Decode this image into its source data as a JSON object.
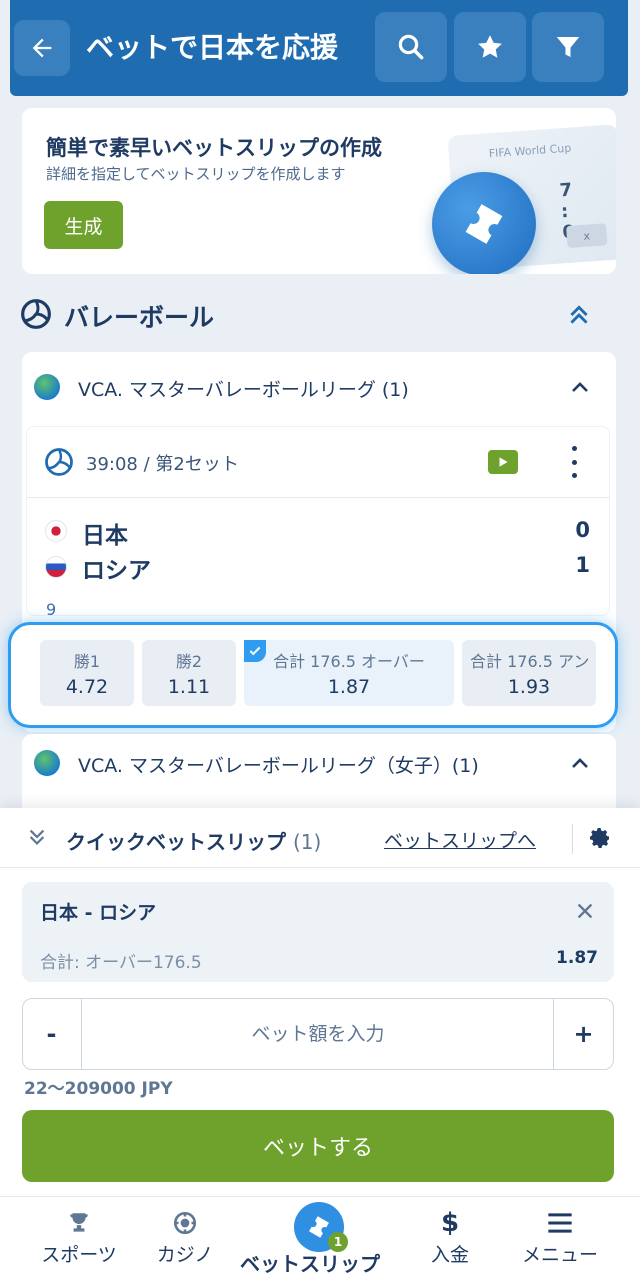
{
  "header": {
    "title": "ベットで日本を応援",
    "back_icon": "arrow-left-icon",
    "search_icon": "search-icon",
    "favorites_icon": "star-icon",
    "filter_icon": "filter-icon"
  },
  "promo": {
    "title": "簡単で素早いベットスリップの作成",
    "subtitle": "詳細を指定してベットスリップを作成します",
    "button_label": "生成",
    "art_cup_label": "FIFA World Cup",
    "art_score": "7 : 0",
    "art_x": "x"
  },
  "sport": {
    "title": "バレーボール",
    "icon": "volleyball-icon"
  },
  "league1": {
    "title": "VCA. マスターバレーボールリーグ (1)"
  },
  "match": {
    "time": "39:08 / 第2セット",
    "home": {
      "name": "日本",
      "score": "0"
    },
    "away": {
      "name": "ロシア",
      "score": "1"
    },
    "set_count": "9"
  },
  "odds": [
    {
      "label": "勝1",
      "value": "4.72",
      "selected": false
    },
    {
      "label": "勝2",
      "value": "1.11",
      "selected": false
    },
    {
      "label": "合計 176.5 オーバー",
      "value": "1.87",
      "selected": true
    },
    {
      "label": "合計 176.5 アン",
      "value": "1.93",
      "selected": false
    }
  ],
  "league2": {
    "title": "VCA. マスターバレーボールリーグ（女子）(1)"
  },
  "quick_betslip": {
    "title": "クイックベットスリップ",
    "count": "(1)",
    "link": "ベットスリップへ",
    "selection": {
      "teams": "日本 - ロシア",
      "market": "合計: オーバー176.5",
      "odd": "1.87"
    },
    "stake_placeholder": "ベット額を入力",
    "minus": "-",
    "plus": "+",
    "limits": "22〜209000 JPY",
    "bet_button": "ベットする"
  },
  "nav": {
    "sports": "スポーツ",
    "casino": "カジノ",
    "betslip": "ベットスリップ",
    "betslip_badge": "1",
    "deposit": "入金",
    "menu": "メニュー"
  },
  "colors": {
    "brand_blue": "#1f6cb0",
    "accent_green": "#6ea22c",
    "highlight_blue": "#2f9cf0",
    "text_dark": "#1f3b63"
  }
}
